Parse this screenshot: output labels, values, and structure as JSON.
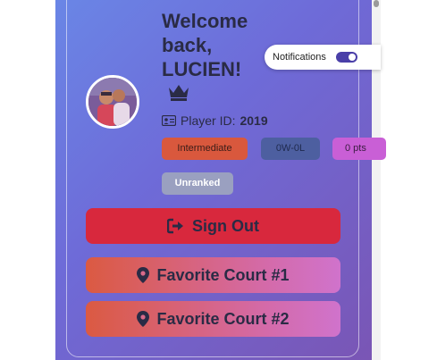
{
  "profile": {
    "welcome": "Welcome back, LUCIEN!",
    "crown_icon": "crown-icon",
    "player_id_label": "Player ID:",
    "player_id": "2019",
    "avatar_icon": "avatar-photo"
  },
  "notifications": {
    "label": "Notifications",
    "enabled": true,
    "toggle_color": "#4a3fa8"
  },
  "badges": {
    "level": "Intermediate",
    "record": "0W-0L",
    "points": "0 pts",
    "rank": "Unranked"
  },
  "actions": {
    "sign_out": "Sign Out",
    "favorite_court_1": "Favorite Court #1",
    "favorite_court_2": "Favorite Court #2"
  },
  "colors": {
    "card_gradient_start": "#6a86e6",
    "card_gradient_end": "#7a55b4",
    "sign_out": "#d8283d",
    "level_badge": "#d9583d",
    "record_badge": "#4d5fa0",
    "points_badge": "#c95fd6",
    "rank_badge": "#9aa0c0"
  }
}
